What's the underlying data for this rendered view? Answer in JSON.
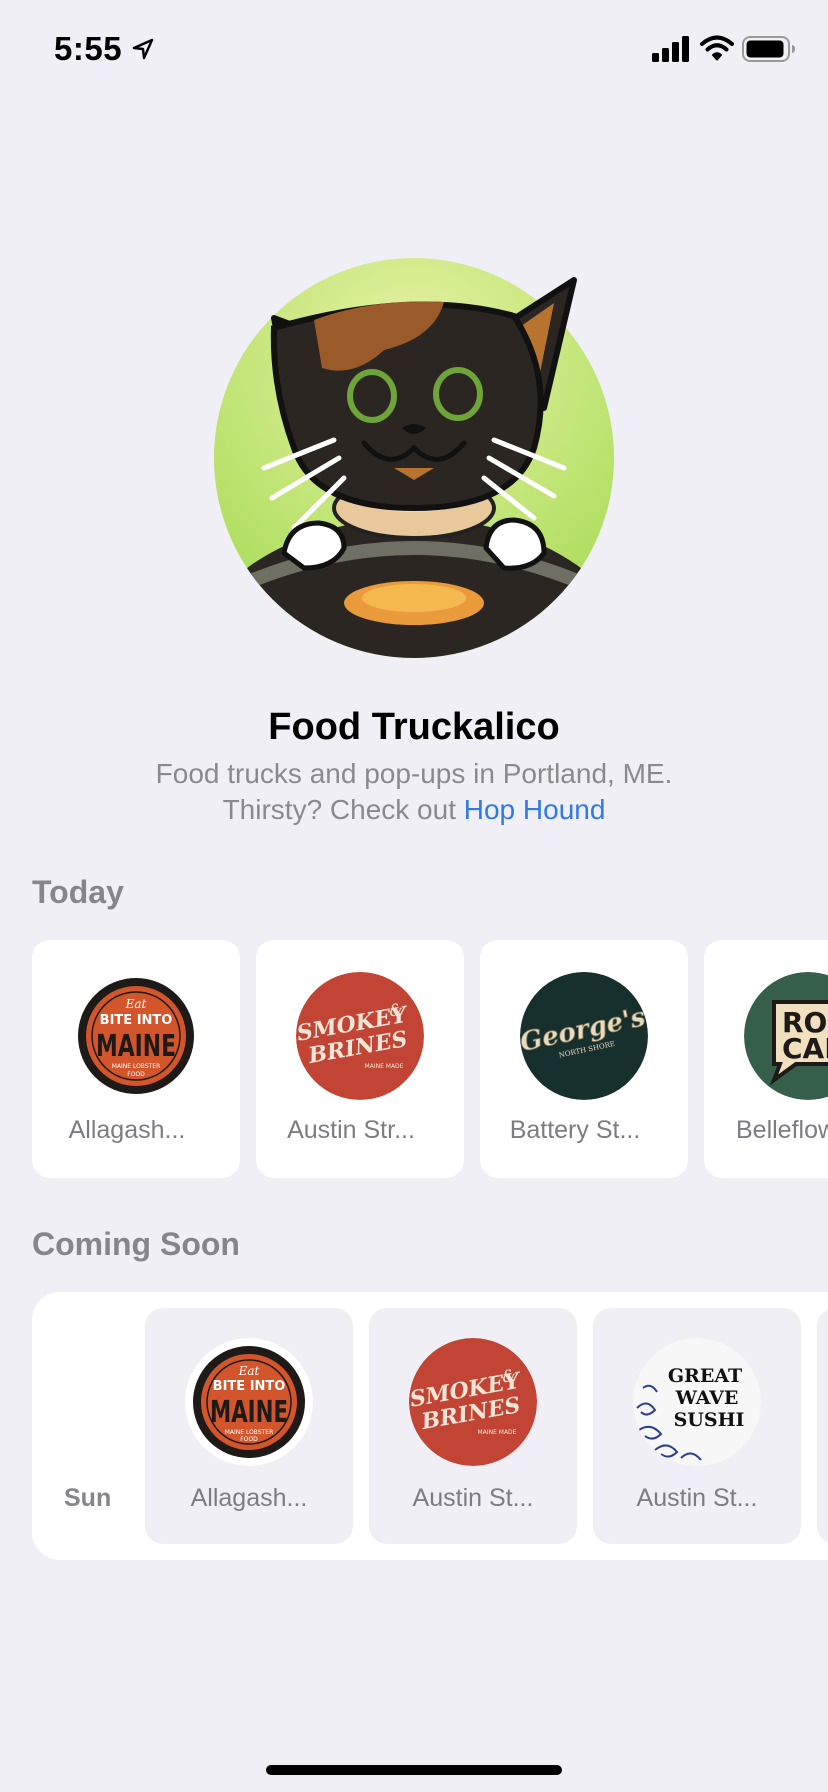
{
  "status_bar": {
    "time": "5:55",
    "icons": [
      "location-arrow-icon",
      "cellular-signal-icon",
      "wifi-icon",
      "battery-icon"
    ]
  },
  "header": {
    "avatar_icon": "cat-in-food-truck-avatar",
    "title": "Food Truckalico",
    "subtitle_line1": "Food trucks and pop-ups in Portland, ME.",
    "subtitle_line2_prefix": "Thirsty? Check out ",
    "subtitle_link": "Hop Hound",
    "link_color": "#2f7ae5"
  },
  "today": {
    "header": "Today",
    "items": [
      {
        "name": "Allagash...",
        "logo": "bite-into-maine-logo"
      },
      {
        "name": "Austin Str...",
        "logo": "smokey-and-brines-logo"
      },
      {
        "name": "Battery St...",
        "logo": "georges-north-shore-logo"
      },
      {
        "name": "Belleflow",
        "logo": "roll-call-logo"
      }
    ]
  },
  "coming_soon": {
    "header": "Coming Soon",
    "day": "Sun",
    "items": [
      {
        "name": "Allagash...",
        "logo": "bite-into-maine-logo"
      },
      {
        "name": "Austin St...",
        "logo": "smokey-and-brines-logo"
      },
      {
        "name": "Austin St...",
        "logo": "great-wave-sushi-logo"
      }
    ]
  },
  "logos": {
    "bite_into_maine": {
      "top": "Eat",
      "line1": "BITE INTO",
      "line2": "MAINE",
      "bottom": "MAINE LOBSTER",
      "bottom2": "FOOD"
    },
    "smokey_brines": {
      "line1": "SMOKEY",
      "amp": "&",
      "line2": "BRINES",
      "tag": "MAINE MADE"
    },
    "georges": {
      "name": "George's",
      "tag": "NORTH SHORE"
    },
    "roll_call": {
      "line1": "ROL",
      "line2": "CAL"
    },
    "great_wave": {
      "line1": "GREAT",
      "line2": "WAVE",
      "line3": "SUSHI"
    }
  },
  "colors": {
    "background": "#f0eff5",
    "card": "#ffffff",
    "smokey_red": "#c24434",
    "georges_dark": "#17302e",
    "roll_call_green": "#355f4a",
    "maine_orange": "#d2552c"
  }
}
